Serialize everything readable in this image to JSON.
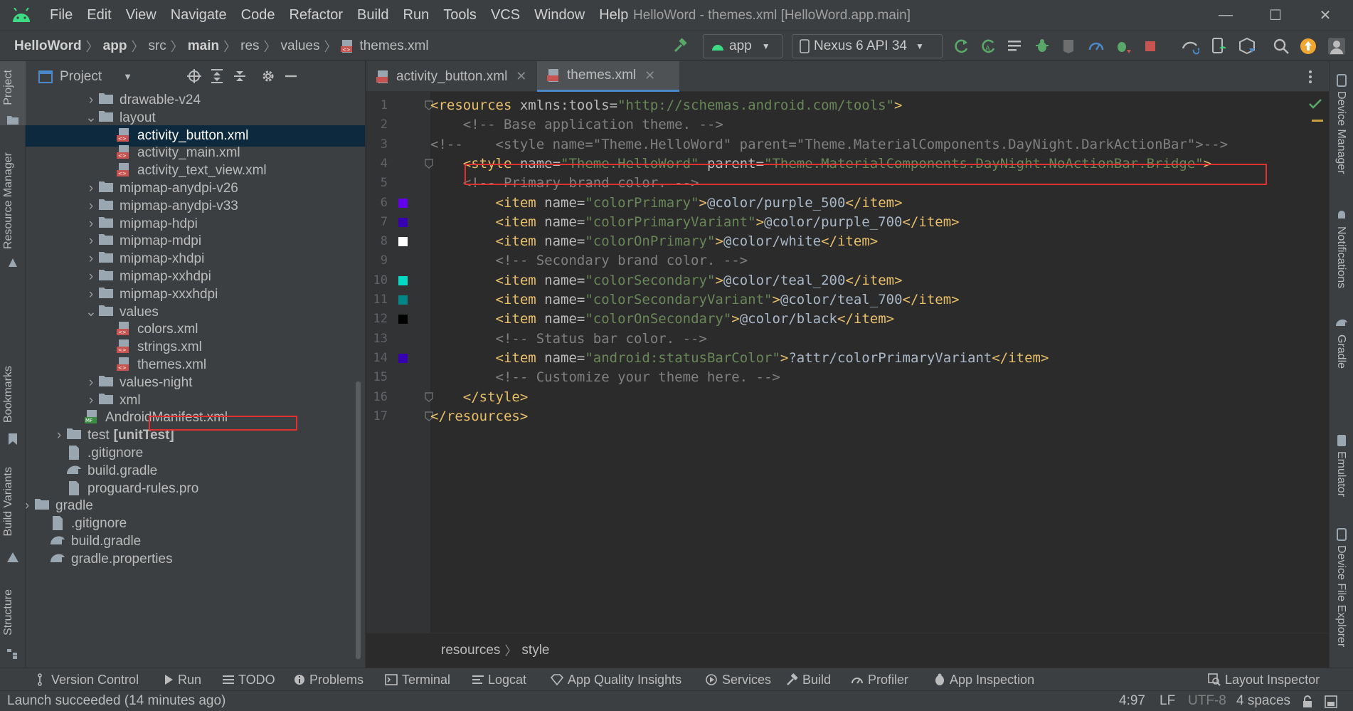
{
  "window": {
    "title": "HelloWord - themes.xml [HelloWord.app.main]",
    "minimize": "—",
    "maximize": "☐",
    "close": "✕"
  },
  "menu": [
    "File",
    "Edit",
    "View",
    "Navigate",
    "Code",
    "Refactor",
    "Build",
    "Run",
    "Tools",
    "VCS",
    "Window",
    "Help"
  ],
  "breadcrumb": {
    "project": "HelloWord",
    "module": "app",
    "p1": "src",
    "p2": "main",
    "p3": "res",
    "p4": "values",
    "file": "themes.xml"
  },
  "toolbar": {
    "run_config": "app",
    "device": "Nexus 6 API 34"
  },
  "side_left": [
    "Project",
    "Resource Manager",
    "Bookmarks",
    "Build Variants",
    "Structure"
  ],
  "side_right": [
    "Device Manager",
    "Notifications",
    "Gradle",
    "Emulator",
    "Device File Explorer"
  ],
  "project_panel": {
    "title": "Project",
    "tree": [
      {
        "label": "drawable-v24",
        "type": "folder",
        "arrow": "›"
      },
      {
        "label": "layout",
        "type": "folder",
        "arrow": "⌄"
      },
      {
        "label": "activity_button.xml",
        "type": "xml",
        "arrow": ""
      },
      {
        "label": "activity_main.xml",
        "type": "xml",
        "arrow": ""
      },
      {
        "label": "activity_text_view.xml",
        "type": "xml",
        "arrow": ""
      },
      {
        "label": "mipmap-anydpi-v26",
        "type": "folder",
        "arrow": "›"
      },
      {
        "label": "mipmap-anydpi-v33",
        "type": "folder",
        "arrow": "›"
      },
      {
        "label": "mipmap-hdpi",
        "type": "folder",
        "arrow": "›"
      },
      {
        "label": "mipmap-mdpi",
        "type": "folder",
        "arrow": "›"
      },
      {
        "label": "mipmap-xhdpi",
        "type": "folder",
        "arrow": "›"
      },
      {
        "label": "mipmap-xxhdpi",
        "type": "folder",
        "arrow": "›"
      },
      {
        "label": "mipmap-xxxhdpi",
        "type": "folder",
        "arrow": "›"
      },
      {
        "label": "values",
        "type": "folder",
        "arrow": "⌄"
      },
      {
        "label": "colors.xml",
        "type": "xml",
        "arrow": ""
      },
      {
        "label": "strings.xml",
        "type": "xml",
        "arrow": ""
      },
      {
        "label": "themes.xml",
        "type": "xml",
        "arrow": ""
      },
      {
        "label": "values-night",
        "type": "folder",
        "arrow": "›"
      },
      {
        "label": "xml",
        "type": "folder",
        "arrow": "›"
      },
      {
        "label": "AndroidManifest.xml",
        "type": "manifest",
        "arrow": ""
      },
      {
        "label": "test",
        "type": "folder",
        "arrow": "›",
        "suffix": "[unitTest]"
      },
      {
        "label": ".gitignore",
        "type": "file",
        "arrow": ""
      },
      {
        "label": "build.gradle",
        "type": "gradle",
        "arrow": ""
      },
      {
        "label": "proguard-rules.pro",
        "type": "file",
        "arrow": ""
      },
      {
        "label": "gradle",
        "type": "folder",
        "arrow": "›"
      },
      {
        "label": ".gitignore",
        "type": "file",
        "arrow": ""
      },
      {
        "label": "build.gradle",
        "type": "gradle",
        "arrow": ""
      },
      {
        "label": "gradle.properties",
        "type": "gradle",
        "arrow": ""
      }
    ]
  },
  "tabs": [
    {
      "label": "activity_button.xml",
      "close": "✕"
    },
    {
      "label": "themes.xml",
      "close": "✕"
    }
  ],
  "code": {
    "line_numbers": [
      "1",
      "2",
      "3",
      "4",
      "5",
      "6",
      "7",
      "8",
      "9",
      "10",
      "11",
      "12",
      "13",
      "14",
      "15",
      "16",
      "17"
    ],
    "l1": {
      "a": "<resources",
      "b": " xmlns:tools=",
      "c": "\"http://schemas.android.com/tools\"",
      "d": ">"
    },
    "l2": "    <!-- Base application theme. -->",
    "l3": "<!--    <style name=\"Theme.HelloWord\" parent=\"Theme.MaterialComponents.DayNight.DarkActionBar\">-->",
    "l4": {
      "a": "    <style",
      "b": " name=",
      "c": "\"Theme.HelloWord\"",
      "d": " parent=",
      "e": "\"Theme.MaterialComponents.DayNight.NoActionBar.Bridge\"",
      "f": ">"
    },
    "l5": "    <!-- Primary brand color. -->",
    "items": [
      {
        "line": "6",
        "name": "\"colorPrimary\"",
        "value": "@color/purple_500",
        "swatch": "#6200EE"
      },
      {
        "line": "7",
        "name": "\"colorPrimaryVariant\"",
        "value": "@color/purple_700",
        "swatch": "#3700B3"
      },
      {
        "line": "8",
        "name": "\"colorOnPrimary\"",
        "value": "@color/white",
        "swatch": "#FFFFFF"
      },
      {
        "line": "10",
        "name": "\"colorSecondary\"",
        "value": "@color/teal_200",
        "swatch": "#03DAC5"
      },
      {
        "line": "11",
        "name": "\"colorSecondaryVariant\"",
        "value": "@color/teal_700",
        "swatch": "#018786"
      },
      {
        "line": "12",
        "name": "\"colorOnSecondary\"",
        "value": "@color/black",
        "swatch": "#000000"
      },
      {
        "line": "14",
        "name": "\"android:statusBarColor\"",
        "value": "?attr/colorPrimaryVariant",
        "swatch": "#3700B3"
      }
    ],
    "item_open": "<item",
    "name_attr": " name=",
    "item_close": "</item>",
    "gt": ">",
    "l9": "        <!-- Secondary brand color. -->",
    "l13": "        <!-- Status bar color. -->",
    "l15": "        <!-- Customize your theme here. -->",
    "l16": "    </style>",
    "l17": "</resources>"
  },
  "editor_breadcrumb": {
    "a": "resources",
    "b": "style"
  },
  "bottom_tools": [
    "Version Control",
    "Run",
    "TODO",
    "Problems",
    "Terminal",
    "Logcat",
    "App Quality Insights",
    "Services",
    "Build",
    "Profiler",
    "App Inspection",
    "Layout Inspector"
  ],
  "status": {
    "message": "Launch succeeded (14 minutes ago)",
    "position": "4:97",
    "line_sep": "LF",
    "encoding": "UTF-8",
    "indent": "4 spaces"
  }
}
